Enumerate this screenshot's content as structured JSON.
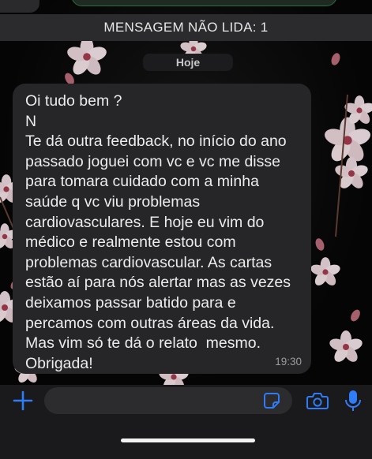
{
  "banner": {
    "unread_label": "MENSAGEM NÃO LIDA: 1"
  },
  "chat": {
    "date_label": "Hoje"
  },
  "message": {
    "text": "Oi tudo bem ?\nN\nTe dá outra feedback, no início do ano passado joguei com vc e vc me disse para tomara cuidado com a minha saúde q vc viu problemas cardiovasculares. E hoje eu vim do médico e realmente estou com problemas cardiovascular. As cartas estão aí para nós alertar mas as vezes deixamos passar batido para e percamos com outras áreas da vida. Mas vim só te dá o relato  mesmo. Obrigada!",
    "time": "19:30"
  },
  "input_bar": {
    "icons": [
      "plus-icon",
      "sticker-icon",
      "camera-icon",
      "microphone-icon"
    ],
    "accent_color": "#2f7cf6"
  },
  "colors": {
    "bubble": "#262628",
    "background": "#0b0b0b",
    "unread_bar": "#2b2b2d"
  }
}
